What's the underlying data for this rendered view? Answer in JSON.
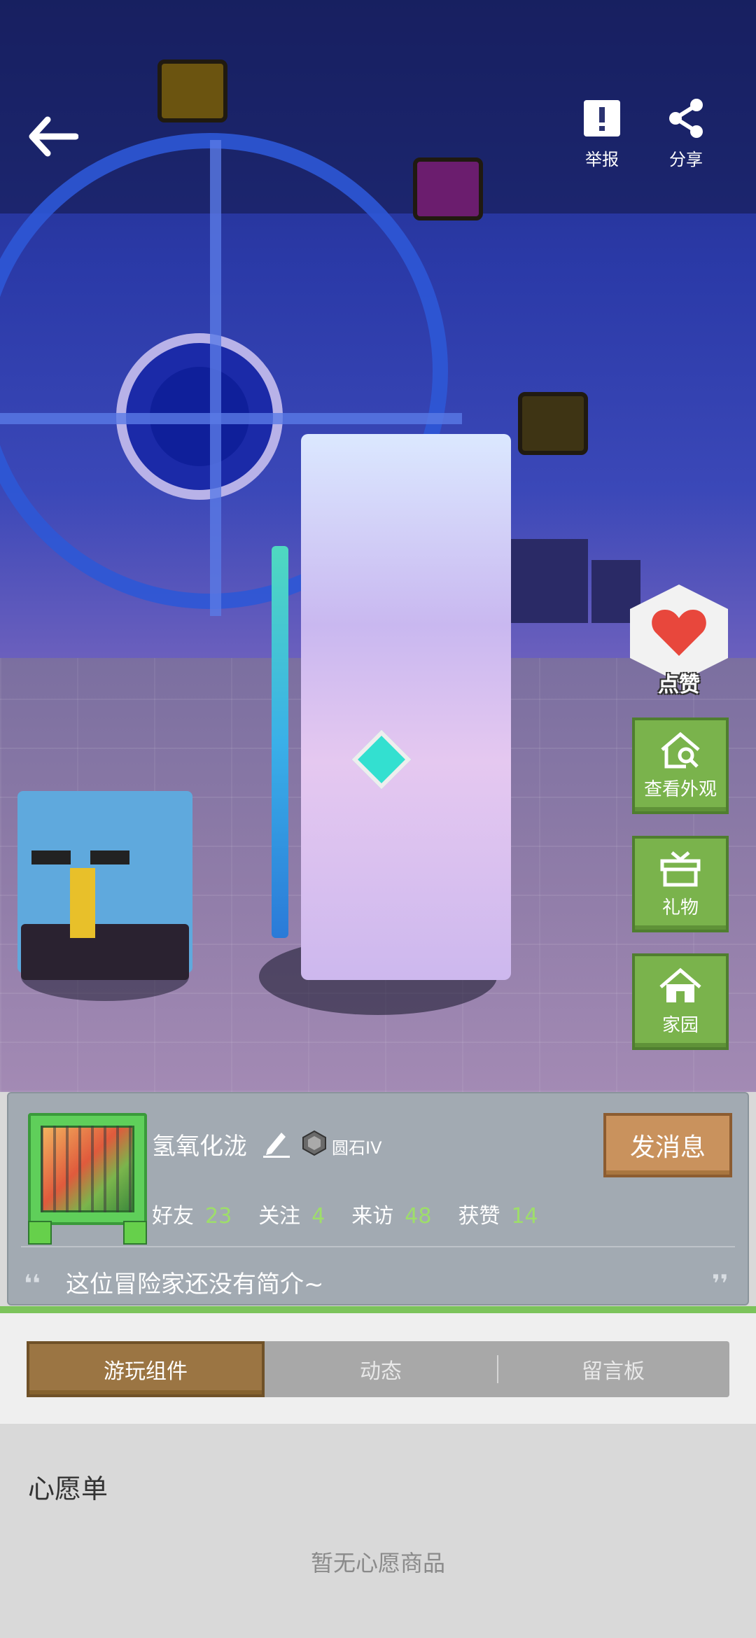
{
  "topbar": {
    "report_label": "举报",
    "share_label": "分享"
  },
  "side": {
    "like_label": "点赞",
    "appearance_label": "查看外观",
    "gift_label": "礼物",
    "home_label": "家园"
  },
  "profile": {
    "username": "氢氧化泷",
    "rank": "圆石IV",
    "message_button": "发消息",
    "stats": [
      {
        "label": "好友",
        "value": "23"
      },
      {
        "label": "关注",
        "value": "4"
      },
      {
        "label": "来访",
        "value": "48"
      },
      {
        "label": "获赞",
        "value": "14"
      }
    ],
    "bio": "这位冒险家还没有简介~",
    "quote_open": "❛❛",
    "quote_close": "❜❜"
  },
  "tabs": [
    {
      "label": "游玩组件",
      "active": true
    },
    {
      "label": "动态",
      "active": false
    },
    {
      "label": "留言板",
      "active": false
    }
  ],
  "wishlist": {
    "title": "心愿单",
    "empty_text": "暂无心愿商品"
  },
  "colors": {
    "accent_green": "#7ab34c",
    "stat_number": "#9ede6a",
    "message_button": "#c9925d",
    "active_tab": "#9b7543"
  }
}
